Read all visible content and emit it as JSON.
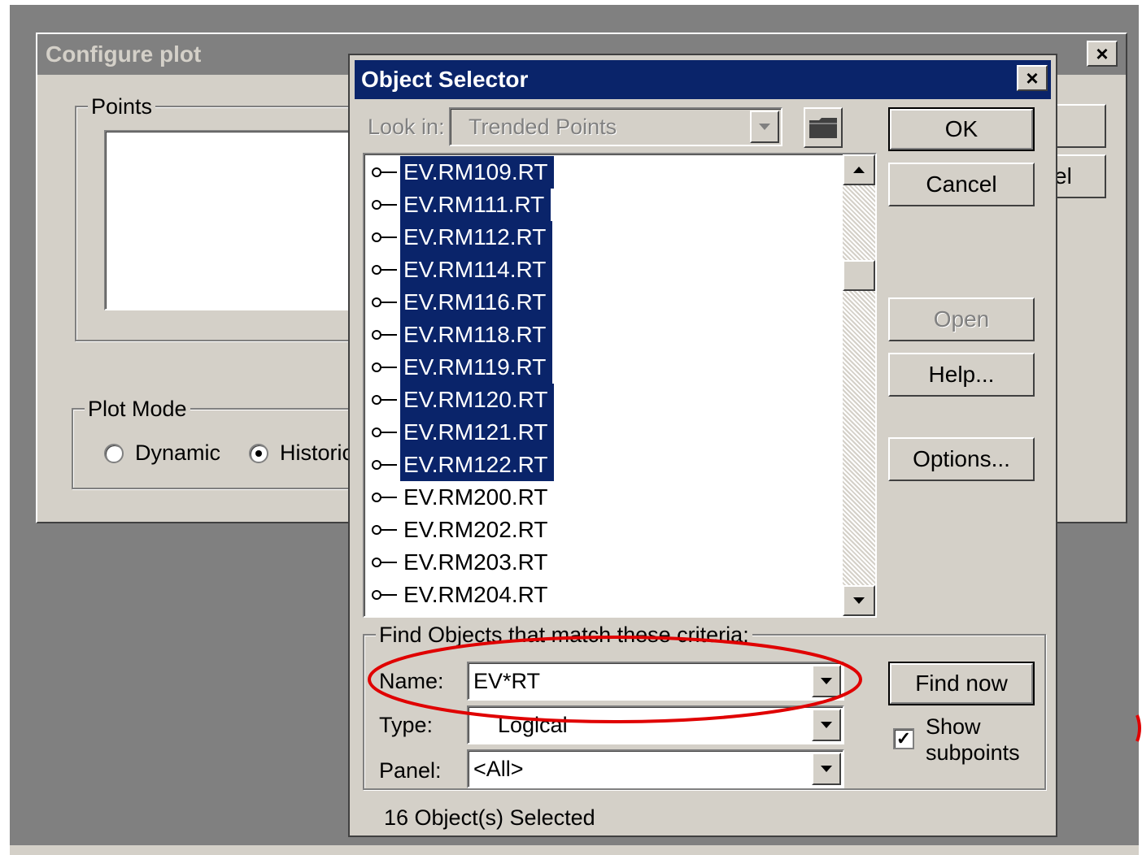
{
  "configure_plot": {
    "title": "Configure plot",
    "close_glyph": "×",
    "points_label": "Points",
    "plot_mode_label": "Plot Mode",
    "dynamic_label": "Dynamic",
    "historic_label": "Historic",
    "cancel_partial": "el",
    "plot_mode_selected": "Historic"
  },
  "object_selector": {
    "title": "Object Selector",
    "close_glyph": "×",
    "look_in_label": "Look in:",
    "look_in_value": "Trended Points",
    "buttons": {
      "ok": "OK",
      "cancel": "Cancel",
      "open": "Open",
      "help": "Help...",
      "options": "Options...",
      "find_now": "Find now"
    },
    "items": [
      {
        "name": "EV.RM109.RT",
        "selected": true
      },
      {
        "name": "EV.RM111.RT",
        "selected": true
      },
      {
        "name": "EV.RM112.RT",
        "selected": true
      },
      {
        "name": "EV.RM114.RT",
        "selected": true
      },
      {
        "name": "EV.RM116.RT",
        "selected": true
      },
      {
        "name": "EV.RM118.RT",
        "selected": true
      },
      {
        "name": "EV.RM119.RT",
        "selected": true
      },
      {
        "name": "EV.RM120.RT",
        "selected": true
      },
      {
        "name": "EV.RM121.RT",
        "selected": true
      },
      {
        "name": "EV.RM122.RT",
        "selected": true
      },
      {
        "name": "EV.RM200.RT",
        "selected": false
      },
      {
        "name": "EV.RM202.RT",
        "selected": false
      },
      {
        "name": "EV.RM203.RT",
        "selected": false
      },
      {
        "name": "EV.RM204.RT",
        "selected": false
      }
    ],
    "find": {
      "group_label": "Find Objects that match these criteria:",
      "name_label": "Name:",
      "name_value": "EV*RT",
      "type_label": "Type:",
      "type_value": "Logical",
      "panel_label": "Panel:",
      "panel_value": "<All>",
      "show_subpoints_label_1": "Show",
      "show_subpoints_label_2": "subpoints",
      "show_subpoints_checked": true,
      "check_glyph": "✓"
    },
    "status": "16 Object(s) Selected"
  },
  "annotation": {
    "highlight_color": "#e00000"
  }
}
